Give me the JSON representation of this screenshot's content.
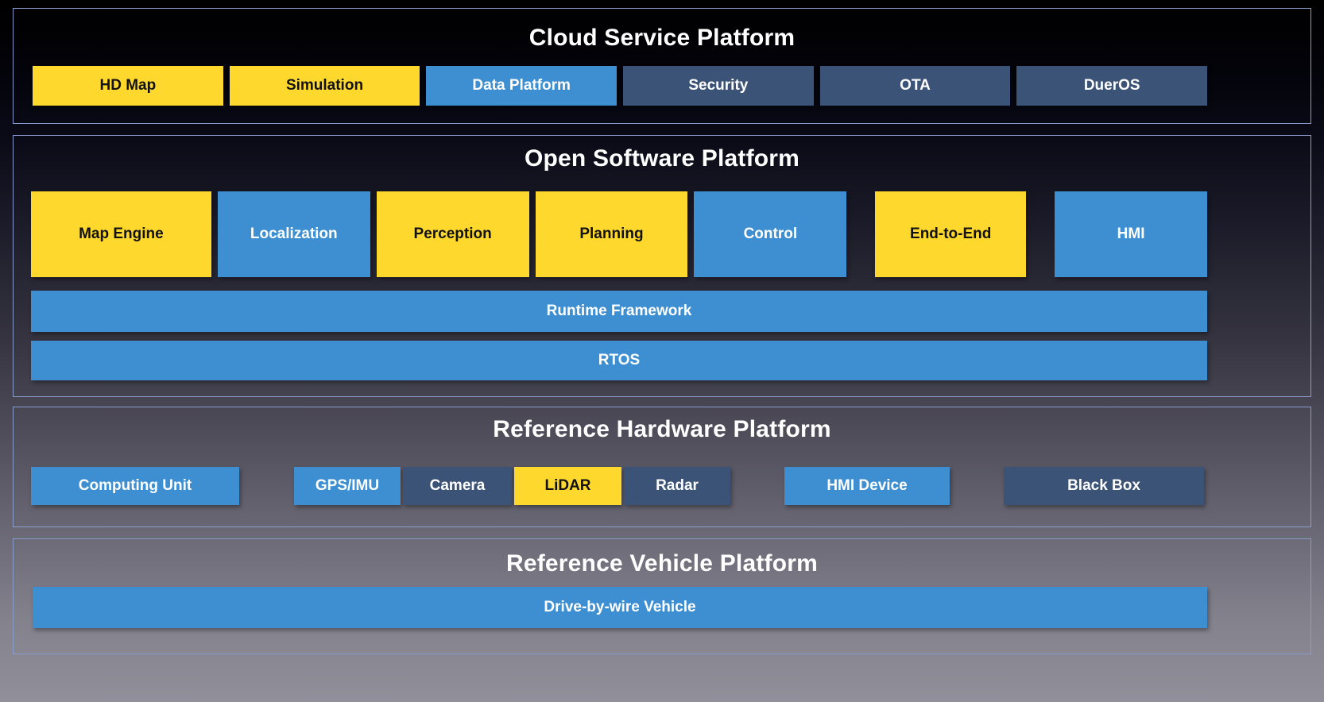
{
  "palette": {
    "yellow": "#FFD82E",
    "blue": "#3E8FD1",
    "slate": "#3B5377",
    "border": "#8A9CCC"
  },
  "cloud": {
    "title": "Cloud Service Platform",
    "items": [
      {
        "label": "HD Map",
        "color": "yellow"
      },
      {
        "label": "Simulation",
        "color": "yellow"
      },
      {
        "label": "Data Platform",
        "color": "blue"
      },
      {
        "label": "Security",
        "color": "slate"
      },
      {
        "label": "OTA",
        "color": "slate"
      },
      {
        "label": "DuerOS",
        "color": "slate"
      }
    ]
  },
  "software": {
    "title": "Open Software Platform",
    "modules": [
      {
        "label": "Map Engine",
        "color": "yellow"
      },
      {
        "label": "Localization",
        "color": "blue"
      },
      {
        "label": "Perception",
        "color": "yellow"
      },
      {
        "label": "Planning",
        "color": "yellow"
      },
      {
        "label": "Control",
        "color": "blue"
      },
      {
        "label": "End-to-End",
        "color": "yellow"
      },
      {
        "label": "HMI",
        "color": "blue"
      }
    ],
    "runtime": {
      "label": "Runtime Framework",
      "color": "blue"
    },
    "rtos": {
      "label": "RTOS",
      "color": "blue"
    }
  },
  "hardware": {
    "title": "Reference Hardware Platform",
    "items": [
      {
        "label": "Computing Unit",
        "color": "blue"
      },
      {
        "label": "GPS/IMU",
        "color": "blue"
      },
      {
        "label": "Camera",
        "color": "slate"
      },
      {
        "label": "LiDAR",
        "color": "yellow"
      },
      {
        "label": "Radar",
        "color": "slate"
      },
      {
        "label": "HMI Device",
        "color": "blue"
      },
      {
        "label": "Black Box",
        "color": "slate"
      }
    ]
  },
  "vehicle": {
    "title": "Reference Vehicle Platform",
    "bar": {
      "label": "Drive-by-wire Vehicle",
      "color": "blue"
    }
  }
}
